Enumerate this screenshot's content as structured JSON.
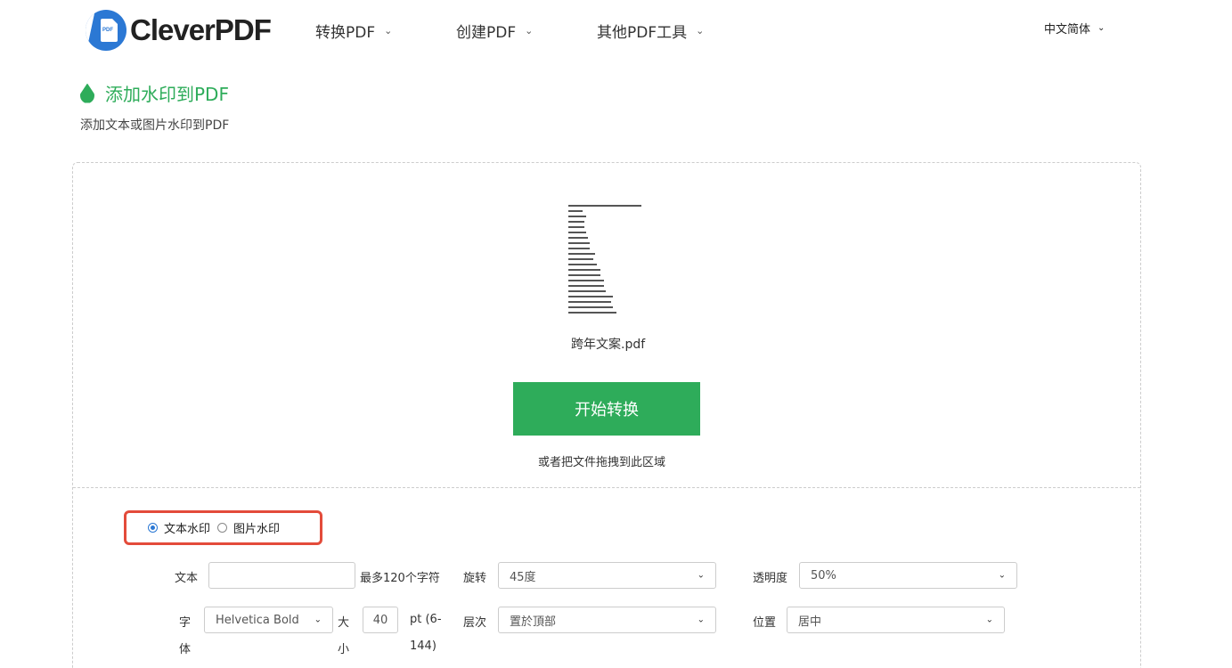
{
  "header": {
    "logo_text": "CleverPDF",
    "logo_mark_text": "PDF",
    "nav": [
      {
        "label": "转换PDF"
      },
      {
        "label": "创建PDF"
      },
      {
        "label": "其他PDF工具"
      }
    ],
    "language": "中文简体"
  },
  "tool": {
    "title": "添加水印到PDF",
    "subtitle": "添加文本或图片水印到PDF",
    "accent_color": "#2eac5a"
  },
  "upload": {
    "file_name": "跨年文案.pdf",
    "start_button": "开始转换",
    "drag_hint": "或者把文件拖拽到此区域"
  },
  "options": {
    "watermark_types": [
      {
        "label": "文本水印",
        "selected": true
      },
      {
        "label": "图片水印",
        "selected": false
      }
    ],
    "text_label": "文本",
    "text_value": "",
    "text_hint": "最多120个字符",
    "rotation_label": "旋转",
    "rotation_value": "45度",
    "opacity_label": "透明度",
    "opacity_value": "50%",
    "font_label_1": "字",
    "font_label_2": "体",
    "font_value": "Helvetica Bold",
    "size_label_1": "大",
    "size_label_2": "小",
    "size_value": "40",
    "size_unit_1": "pt (6-",
    "size_unit_2": "144)",
    "layer_label": "层次",
    "layer_value": "置於頂部",
    "position_label": "位置",
    "position_value": "居中"
  },
  "icons": {
    "chevron": "chevron-down-icon",
    "drop": "water-drop-icon"
  }
}
